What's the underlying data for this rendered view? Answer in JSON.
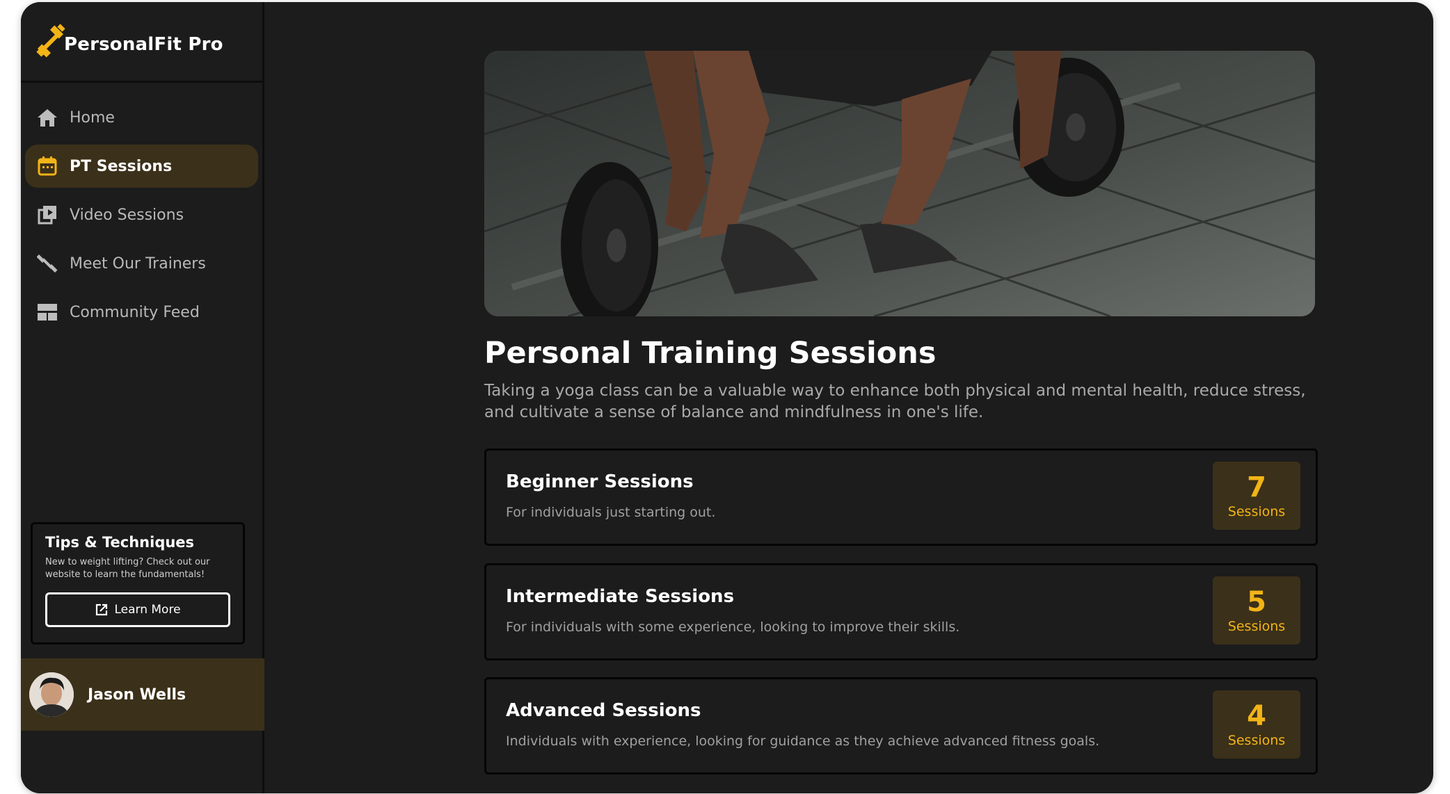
{
  "brand": {
    "name": "PersonalFit Pro",
    "icon": "dumbbell-icon",
    "accent": "#f2b417"
  },
  "nav": [
    {
      "label": "Home",
      "icon": "home-icon",
      "active": false
    },
    {
      "label": "PT Sessions",
      "icon": "calendar-icon",
      "active": true
    },
    {
      "label": "Video Sessions",
      "icon": "video-library-icon",
      "active": false
    },
    {
      "label": "Meet Our Trainers",
      "icon": "dumbbell-icon",
      "active": false
    },
    {
      "label": "Community Feed",
      "icon": "feed-icon",
      "active": false
    }
  ],
  "tips": {
    "title": "Tips & Techniques",
    "text": "New to weight lifting? Check out our website to learn the fundamentals!",
    "button": "Learn More"
  },
  "user": {
    "name": "Jason Wells"
  },
  "main": {
    "title": "Personal Training Sessions",
    "description": "Taking a yoga class can be a valuable way to enhance both physical and mental health, reduce stress, and cultivate a sense of balance and mindfulness in one's life.",
    "levels": [
      {
        "title": "Beginner Sessions",
        "description": "For individuals just starting out.",
        "count": "7",
        "unit": "Sessions"
      },
      {
        "title": "Intermediate Sessions",
        "description": "For individuals with some experience, looking to improve their skills.",
        "count": "5",
        "unit": "Sessions"
      },
      {
        "title": "Advanced Sessions",
        "description": "Individuals with experience, looking for guidance as they achieve advanced fitness goals.",
        "count": "4",
        "unit": "Sessions"
      }
    ]
  }
}
